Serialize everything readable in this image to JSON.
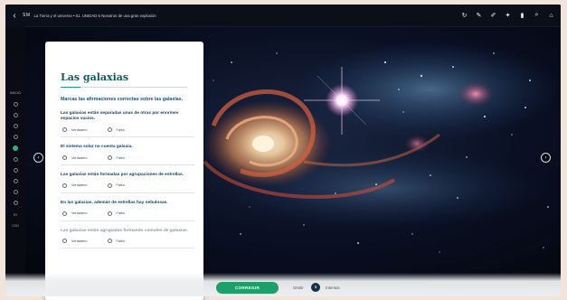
{
  "topbar": {
    "back_icon": "back-arrow-icon",
    "logo": "SM",
    "breadcrumb": "La Tierra y el universo • 01. UNIDAD 6 Nosotros de una gran explosión",
    "tools": [
      "refresh-icon",
      "pencil-icon",
      "marker-icon",
      "star-icon",
      "bookmark-icon",
      "search-icon",
      "home-icon"
    ]
  },
  "leftnav": {
    "index_label": "INICIO",
    "dots": 11,
    "active_dot": 4,
    "bottom_labels": [
      "EV",
      "CON"
    ]
  },
  "card": {
    "title": "Las galaxias",
    "instruction": "Marcas las afirmaciones correctas sobre las galaxias.",
    "questions": [
      {
        "text": "Las galaxias están separadas unas de otras por enormes espacios vacíos.",
        "opt_true": "Verdadero",
        "opt_false": "Falso"
      },
      {
        "text": "El sistema solar no cuenta galaxia.",
        "opt_true": "Verdadero",
        "opt_false": "Falso"
      },
      {
        "text": "Las galaxias están formadas por agrupaciones de estrellas.",
        "opt_true": "Verdadero",
        "opt_false": "Falso"
      },
      {
        "text": "En las galaxias, además de estrellas hay nebulosas.",
        "opt_true": "Verdadero",
        "opt_false": "Falso"
      },
      {
        "text": "Las galaxias están agrupadas formando cúmulos de galaxias.",
        "opt_true": "Verdadero",
        "opt_false": "Falso"
      }
    ]
  },
  "bottombar": {
    "main_button": "CORREGIR",
    "left_label": "Omitir",
    "count": "1",
    "right_label": "Intentos"
  },
  "colors": {
    "accent_green": "#1e9e6a",
    "title_teal": "#0e5d5b",
    "navy": "#12324a"
  }
}
